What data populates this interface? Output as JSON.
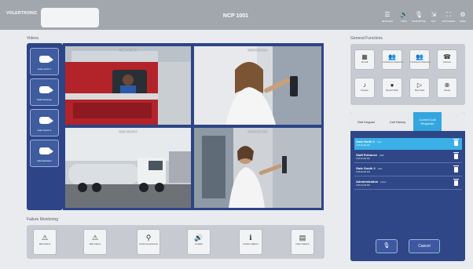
{
  "header": {
    "logo": "VOLERTRONIC",
    "title": "NCP 1001",
    "buttons": [
      {
        "label": "MESSAGES",
        "icon": "list-icon",
        "glyph": "☰"
      },
      {
        "label": "AUDIO",
        "icon": "speaker-icon",
        "glyph": "🔈"
      },
      {
        "label": "MICROPHONE",
        "icon": "microphone-icon",
        "glyph": "🎙"
      },
      {
        "label": "EXIT",
        "icon": "exit-icon",
        "glyph": "⇲"
      },
      {
        "label": "FULLSCREEN",
        "icon": "fullscreen-icon",
        "glyph": "⛶"
      },
      {
        "label": "MORE",
        "icon": "gear-icon",
        "glyph": "⚙"
      }
    ]
  },
  "videos": {
    "label": "Videos",
    "cameras": [
      {
        "label": "Gate North 1"
      },
      {
        "label": "Staff Entrance"
      },
      {
        "label": "Gate South 2"
      },
      {
        "label": "Administration"
      }
    ],
    "tiles": [
      {
        "name": "Gate North 1"
      },
      {
        "name": "Staff Entrance"
      },
      {
        "name": "Gate South 2"
      },
      {
        "name": "Administration"
      }
    ]
  },
  "general_functions": {
    "label": "General Functions",
    "buttons": [
      {
        "label": "All Call",
        "icon": "all-call-icon",
        "glyph": "▦"
      },
      {
        "label": "Conference Channel 1",
        "icon": "group-icon",
        "glyph": "👥"
      },
      {
        "label": "Conference Channel 2",
        "icon": "group-icon",
        "glyph": "👥"
      },
      {
        "label": "Intercom",
        "icon": "intercom-icon",
        "glyph": "☎"
      },
      {
        "label": "Process",
        "icon": "music-note-icon",
        "glyph": "♪"
      },
      {
        "label": "Record Track",
        "icon": "record-icon",
        "glyph": "●"
      },
      {
        "label": "Play Track",
        "icon": "play-icon",
        "glyph": "▷"
      },
      {
        "label": "Cancel",
        "icon": "cancel-icon",
        "glyph": "⊗"
      }
    ]
  },
  "call_panel": {
    "tabs": [
      {
        "label": "Dial Keypad"
      },
      {
        "label": "Call History"
      },
      {
        "label": "Current Call Requests"
      }
    ],
    "requests": [
      {
        "name": "Gate North 1",
        "tag": "Gate",
        "time": "4:35:20 AM PM"
      },
      {
        "name": "Staff Entrance",
        "tag": "Staff",
        "time": "4:35:20 AM PM"
      },
      {
        "name": "Gate South 2",
        "tag": "Gate",
        "time": "4:35:20 AM PM"
      },
      {
        "name": "Administration",
        "tag": "Admin",
        "time": "4:35:20 AM PM"
      }
    ],
    "mic_glyph": "🎙",
    "cancel_label": "Cancel"
  },
  "failure_monitoring": {
    "label": "Failure Monitoring",
    "buttons": [
      {
        "label": "Main Failure",
        "icon": "warning-icon",
        "glyph": "⚠"
      },
      {
        "label": "Main Failure",
        "icon": "warning-icon",
        "glyph": "⚠"
      },
      {
        "label": "Control Components",
        "icon": "component-icon",
        "glyph": "⚲"
      },
      {
        "label": "Amplifier",
        "icon": "amplifier-icon",
        "glyph": "🔊"
      },
      {
        "label": "Outdoor Stations",
        "icon": "station-icon",
        "glyph": "ℹ"
      },
      {
        "label": "Indoor Stations",
        "icon": "indoor-station-icon",
        "glyph": "▤"
      }
    ]
  }
}
